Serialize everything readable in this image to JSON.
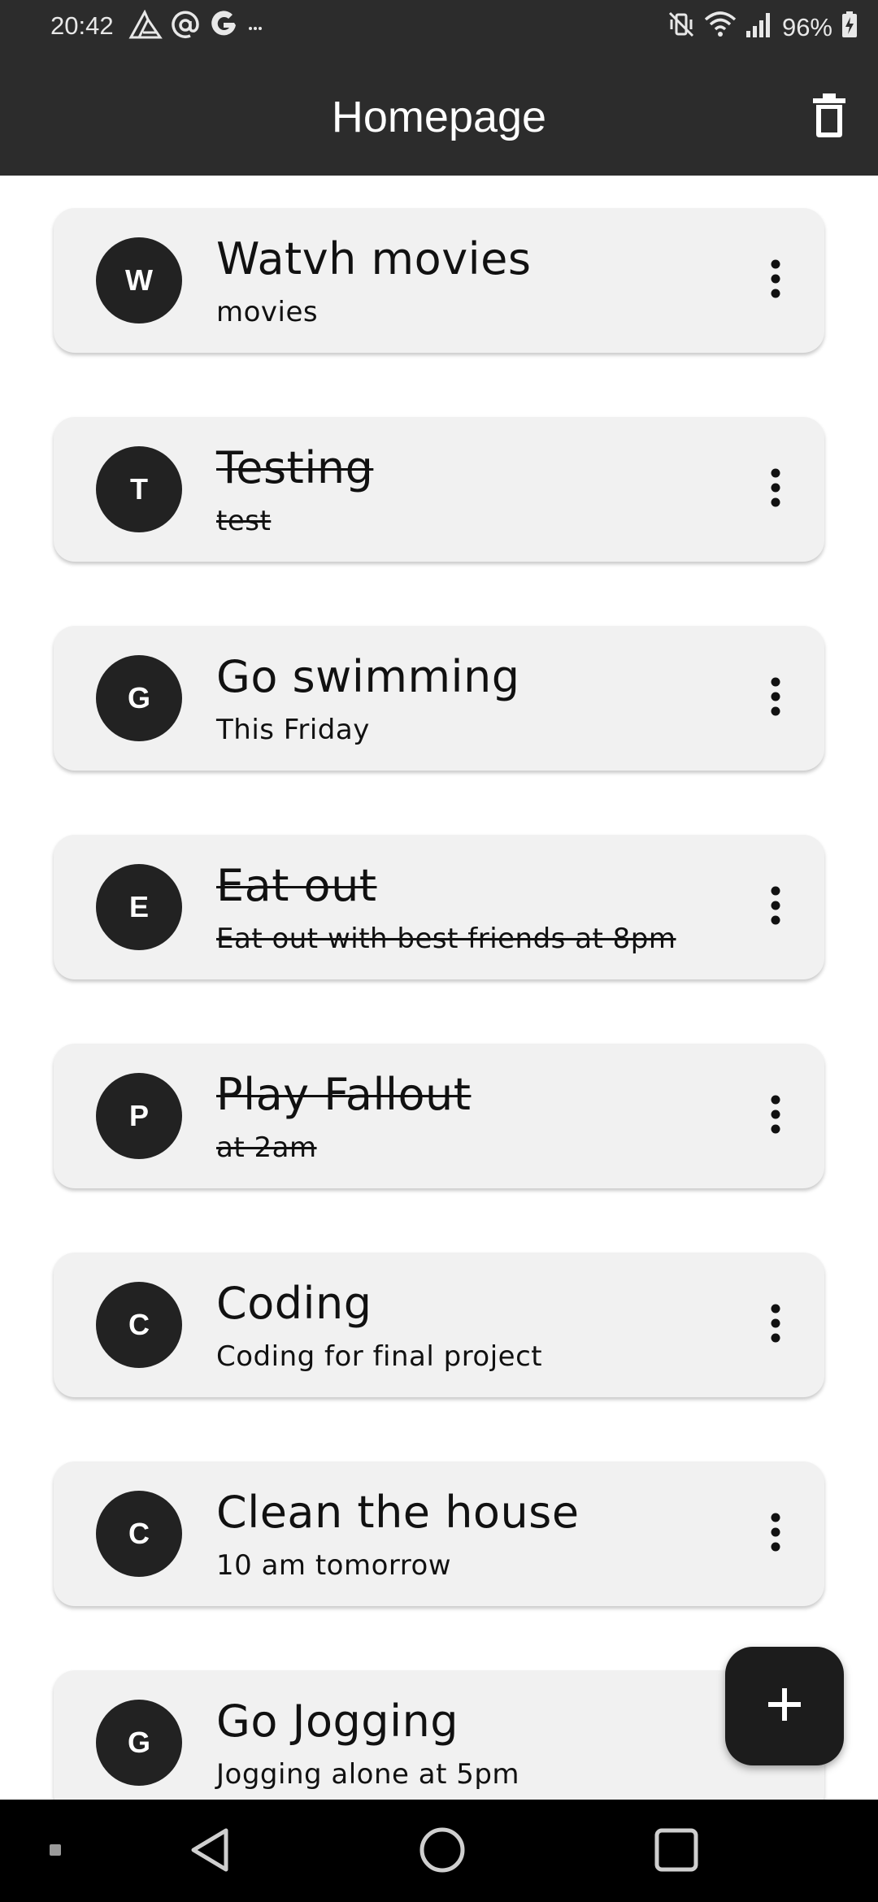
{
  "status_bar": {
    "time": "20:42",
    "battery": "96%",
    "left_icons": [
      "sketch-app-icon",
      "at-sign-icon",
      "google-icon",
      "more-notifications-icon"
    ],
    "right_icons": [
      "mute-vibrate-icon",
      "wifi-icon",
      "cell-signal-icon",
      "battery-charging-icon"
    ]
  },
  "header": {
    "title": "Homepage",
    "action_icon": "trash-icon"
  },
  "tasks": [
    {
      "initial": "W",
      "title": "Watvh movies",
      "subtitle": "movies",
      "completed": false
    },
    {
      "initial": "T",
      "title": "Testing",
      "subtitle": "test",
      "completed": true
    },
    {
      "initial": "G",
      "title": "Go swimming",
      "subtitle": "This Friday",
      "completed": false
    },
    {
      "initial": "E",
      "title": "Eat out",
      "subtitle": "Eat out with best friends at 8pm",
      "completed": true
    },
    {
      "initial": "P",
      "title": "Play Fallout",
      "subtitle": "at 2am",
      "completed": true
    },
    {
      "initial": "C",
      "title": "Coding",
      "subtitle": "Coding for final project",
      "completed": false
    },
    {
      "initial": "C",
      "title": "Clean the house",
      "subtitle": "10 am tomorrow",
      "completed": false
    },
    {
      "initial": "G",
      "title": "Go Jogging",
      "subtitle": "Jogging alone at 5pm",
      "completed": false
    }
  ],
  "fab": {
    "icon": "plus-icon"
  },
  "nav_bar": {
    "icons": [
      "recents-dot-icon",
      "back-icon",
      "home-icon",
      "overview-icon"
    ]
  },
  "colors": {
    "header_background": "#2c2c2c",
    "card_background": "#f1f1f1",
    "avatar_background": "#222222",
    "fab_background": "#1c1c1c",
    "nav_background": "#000000"
  }
}
